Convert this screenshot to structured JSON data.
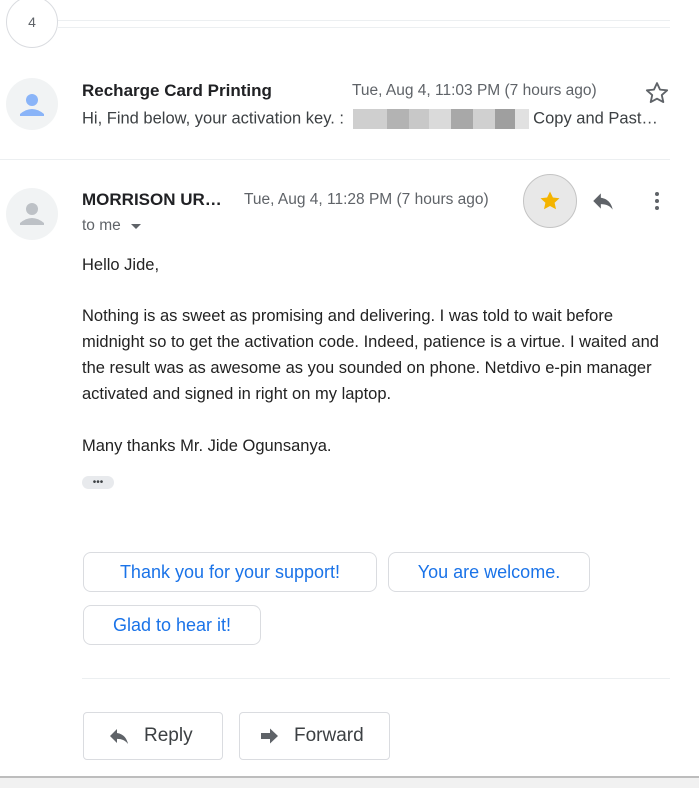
{
  "thread": {
    "collapsed_count": "4"
  },
  "messages": [
    {
      "sender": "Recharge Card Printing",
      "date": "Tue, Aug 4, 11:03 PM (7 hours ago)",
      "snippet_prefix": "Hi, Find below, your activation key. :",
      "snippet_suffix": "Copy and Past…",
      "starred": false
    },
    {
      "sender": "MORRISON UR…",
      "date": "Tue, Aug 4, 11:28 PM (7 hours ago)",
      "recipient": "to me",
      "starred": true,
      "greeting": "Hello Jide,",
      "paragraph": "Nothing is as sweet as promising and delivering. I was told to wait before midnight so to get the activation code. Indeed, patience is a virtue. I waited and the result was as awesome as you sounded on phone. Netdivo e-pin manager activated and signed in right on my laptop.",
      "closing": "Many thanks Mr. Jide Ogunsanya.",
      "trimmed_indicator": "•••"
    }
  ],
  "smart_replies": [
    "Thank you for your support!",
    "You are welcome.",
    "Glad to hear it!"
  ],
  "actions": {
    "reply": "Reply",
    "forward": "Forward"
  },
  "icons": {
    "avatar": "person-icon",
    "star_empty": "star-outline-icon",
    "star_filled": "star-filled-icon",
    "reply": "reply-icon",
    "more": "more-vert-icon",
    "forward": "forward-icon",
    "dropdown": "caret-down-icon"
  },
  "colors": {
    "star": "#f4b400",
    "link": "#1a73e8",
    "avatar_bg": "#f1f3f4"
  }
}
